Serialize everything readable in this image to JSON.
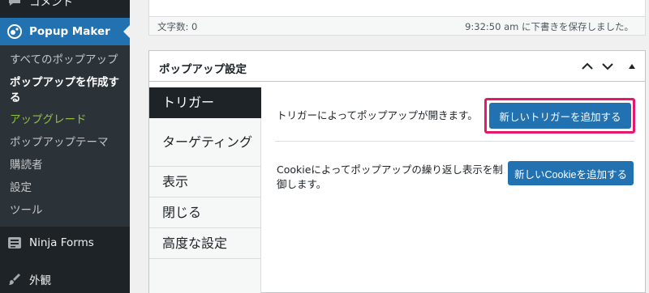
{
  "sidebar": {
    "comments_label": "コメント",
    "popup_maker_label": "Popup Maker",
    "submenu": [
      "すべてのポップアップ",
      "ポップアップを作成する",
      "アップグレード",
      "ポップアップテーマ",
      "購読者",
      "設定",
      "ツール"
    ],
    "ninja_forms_label": "Ninja Forms",
    "appearance_label": "外観"
  },
  "editor_status": {
    "word_count": "文字数: 0",
    "autosave": "9:32:50 am に下書きを保存しました。"
  },
  "popup_settings": {
    "title": "ポップアップ設定",
    "tabs": [
      "トリガー",
      "ターゲティング",
      "表示",
      "閉じる",
      "高度な設定"
    ],
    "active_tab": "トリガー",
    "trigger_text": "トリガーによってポップアップが開きます。",
    "add_trigger_label": "新しいトリガーを追加する",
    "cookie_text": "Cookieによってポップアップの繰り返し表示を制御します。",
    "add_cookie_label": "新しいCookieを追加する"
  },
  "colors": {
    "sidebar_bg": "#1d2327",
    "submenu_bg": "#2c3338",
    "accent": "#2271b1",
    "upgrade": "#8fc13e",
    "highlight": "#e6186e"
  },
  "icons": [
    "comment-icon",
    "popup-maker-icon",
    "ninja-forms-icon",
    "appearance-icon",
    "chevron-up-icon",
    "chevron-down-icon",
    "toggle-triangle-icon"
  ]
}
